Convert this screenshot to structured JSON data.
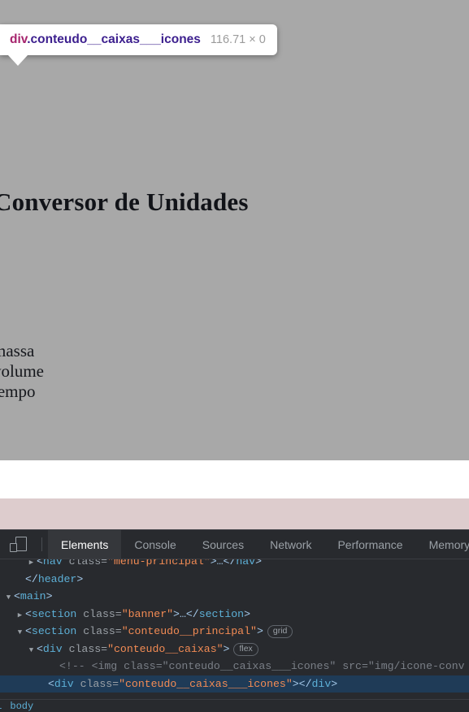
{
  "page": {
    "title": "Conversor de Unidades",
    "unit_list": [
      "massa",
      "volume",
      "tempo"
    ],
    "overlay_color": "#a8a8a8",
    "pink_band_color": "#ddcccd"
  },
  "inspector_tooltip": {
    "element": "div",
    "classes": ".conteudo__caixas___icones",
    "dimensions": "116.71 × 0",
    "element_color": "#a6246d",
    "class_color": "#3c1f8e"
  },
  "devtools": {
    "device_toolbar_icon": "device-toolbar-icon",
    "tabs": [
      {
        "label": "Elements",
        "active": true
      },
      {
        "label": "Console",
        "active": false
      },
      {
        "label": "Sources",
        "active": false
      },
      {
        "label": "Network",
        "active": false
      },
      {
        "label": "Performance",
        "active": false
      },
      {
        "label": "Memory",
        "active": false
      }
    ],
    "dom_rows": [
      {
        "indent": 2,
        "twisty": "closed",
        "selected": false,
        "parts": [
          {
            "t": "punc",
            "v": "<"
          },
          {
            "t": "tag",
            "v": "nav"
          },
          {
            "t": "attr",
            "v": " class="
          },
          {
            "t": "val",
            "v": "\"menu-principal\""
          },
          {
            "t": "punc",
            "v": ">…</"
          },
          {
            "t": "tag",
            "v": "nav"
          },
          {
            "t": "punc",
            "v": ">"
          }
        ]
      },
      {
        "indent": 1,
        "twisty": "none",
        "selected": false,
        "parts": [
          {
            "t": "punc",
            "v": "</"
          },
          {
            "t": "tag",
            "v": "header"
          },
          {
            "t": "punc",
            "v": ">"
          }
        ]
      },
      {
        "indent": 0,
        "twisty": "open",
        "selected": false,
        "parts": [
          {
            "t": "punc",
            "v": "<"
          },
          {
            "t": "tag",
            "v": "main"
          },
          {
            "t": "punc",
            "v": ">"
          }
        ]
      },
      {
        "indent": 1,
        "twisty": "closed",
        "selected": false,
        "parts": [
          {
            "t": "punc",
            "v": "<"
          },
          {
            "t": "tag",
            "v": "section"
          },
          {
            "t": "attr",
            "v": " class="
          },
          {
            "t": "val",
            "v": "\"banner\""
          },
          {
            "t": "punc",
            "v": ">…</"
          },
          {
            "t": "tag",
            "v": "section"
          },
          {
            "t": "punc",
            "v": ">"
          }
        ]
      },
      {
        "indent": 1,
        "twisty": "open",
        "selected": false,
        "badge": "grid",
        "parts": [
          {
            "t": "punc",
            "v": "<"
          },
          {
            "t": "tag",
            "v": "section"
          },
          {
            "t": "attr",
            "v": " class="
          },
          {
            "t": "val",
            "v": "\"conteudo__principal\""
          },
          {
            "t": "punc",
            "v": ">"
          }
        ]
      },
      {
        "indent": 2,
        "twisty": "open",
        "selected": false,
        "badge": "flex",
        "parts": [
          {
            "t": "punc",
            "v": "<"
          },
          {
            "t": "tag",
            "v": "div"
          },
          {
            "t": "attr",
            "v": " class="
          },
          {
            "t": "val",
            "v": "\"conteudo__caixas\""
          },
          {
            "t": "punc",
            "v": ">"
          }
        ]
      },
      {
        "indent": 4,
        "twisty": "none",
        "selected": false,
        "parts": [
          {
            "t": "comment",
            "v": "<!-- <img class=\"conteudo__caixas___icones\" src=\"img/icone-conv"
          }
        ]
      },
      {
        "indent": 3,
        "twisty": "none",
        "selected": true,
        "parts": [
          {
            "t": "punc",
            "v": "<"
          },
          {
            "t": "tag",
            "v": "div"
          },
          {
            "t": "attr",
            "v": " class="
          },
          {
            "t": "val",
            "v": "\"conteudo__caixas___icones\""
          },
          {
            "t": "punc",
            "v": "></"
          },
          {
            "t": "tag",
            "v": "div"
          },
          {
            "t": "punc",
            "v": ">"
          }
        ]
      }
    ],
    "breadcrumb": [
      "al",
      "body"
    ]
  }
}
